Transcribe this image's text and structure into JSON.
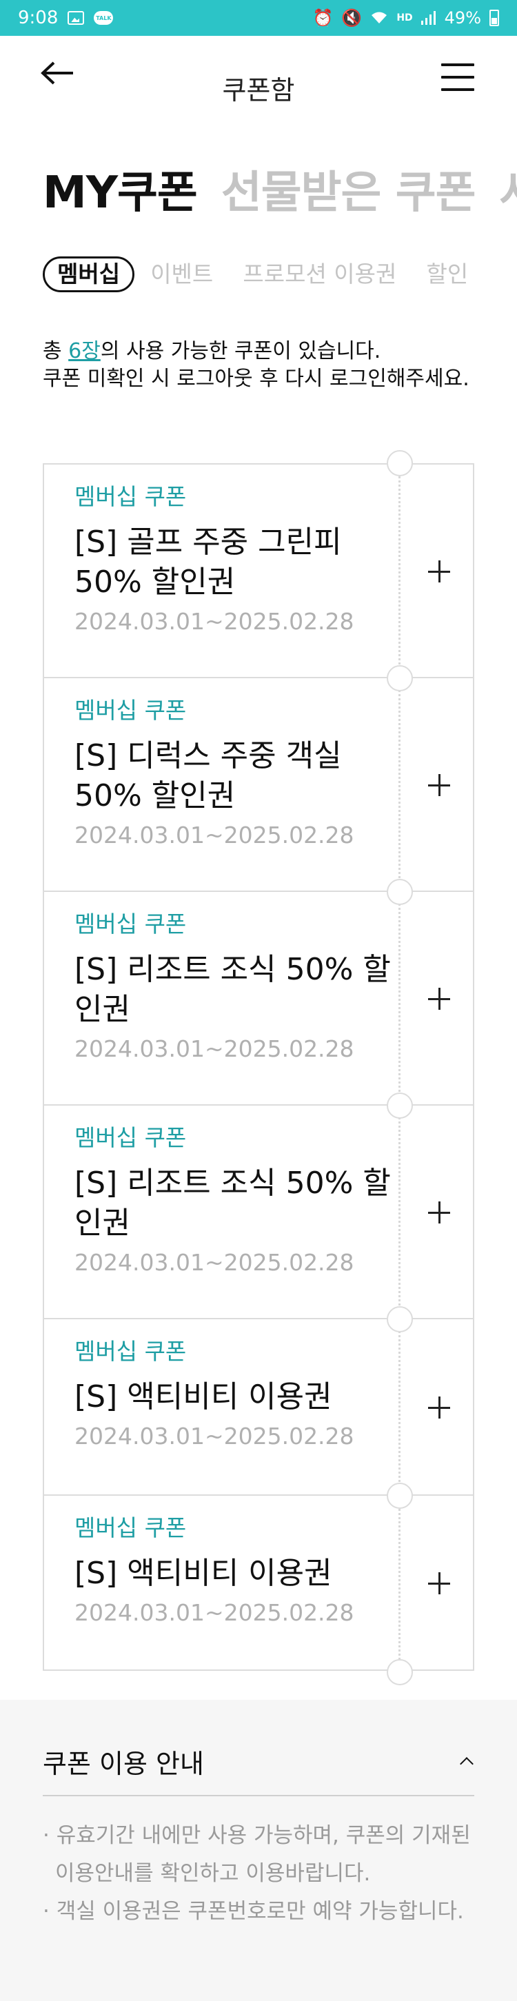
{
  "status_bar": {
    "time": "9:08",
    "talk_label": "TALK",
    "battery": "49%",
    "network": "HD"
  },
  "header": {
    "title": "쿠폰함"
  },
  "main_tabs": [
    {
      "label": "MY쿠폰",
      "active": true
    },
    {
      "label": "선물받은 쿠폰",
      "active": false
    },
    {
      "label": "사",
      "active": false
    }
  ],
  "sub_tabs": [
    {
      "label": "멤버십",
      "active": true
    },
    {
      "label": "이벤트",
      "active": false
    },
    {
      "label": "프로모션 이용권",
      "active": false
    },
    {
      "label": "할인",
      "active": false
    }
  ],
  "info": {
    "prefix": "총 ",
    "count": "6장",
    "suffix": "의 사용 가능한 쿠폰이 있습니다.",
    "line2": "쿠폰 미확인 시 로그아웃 후 다시 로그인해주세요."
  },
  "coupons": [
    {
      "type": "멤버십 쿠폰",
      "name": "[S] 골프 주중 그린피 50% 할인권",
      "period": "2024.03.01~2025.02.28"
    },
    {
      "type": "멤버십 쿠폰",
      "name": "[S] 디럭스 주중 객실 50% 할인권",
      "period": "2024.03.01~2025.02.28"
    },
    {
      "type": "멤버십 쿠폰",
      "name": "[S] 리조트 조식 50% 할인권",
      "period": "2024.03.01~2025.02.28"
    },
    {
      "type": "멤버십 쿠폰",
      "name": "[S] 리조트 조식 50% 할인권",
      "period": "2024.03.01~2025.02.28"
    },
    {
      "type": "멤버십 쿠폰",
      "name": "[S] 액티비티 이용권",
      "period": "2024.03.01~2025.02.28"
    },
    {
      "type": "멤버십 쿠폰",
      "name": "[S] 액티비티 이용권",
      "period": "2024.03.01~2025.02.28"
    }
  ],
  "guide": {
    "title": "쿠폰 이용 안내",
    "items": [
      "유효기간 내에만 사용 가능하며, 쿠폰의 기재된 이용안내를 확인하고 이용바랍니다.",
      "객실 이용권은 쿠폰번호로만 예약 가능합니다."
    ]
  },
  "colors": {
    "accent": "#1e9ea4",
    "status_bar": "#2cc4c7",
    "muted": "#c4c4c4"
  }
}
